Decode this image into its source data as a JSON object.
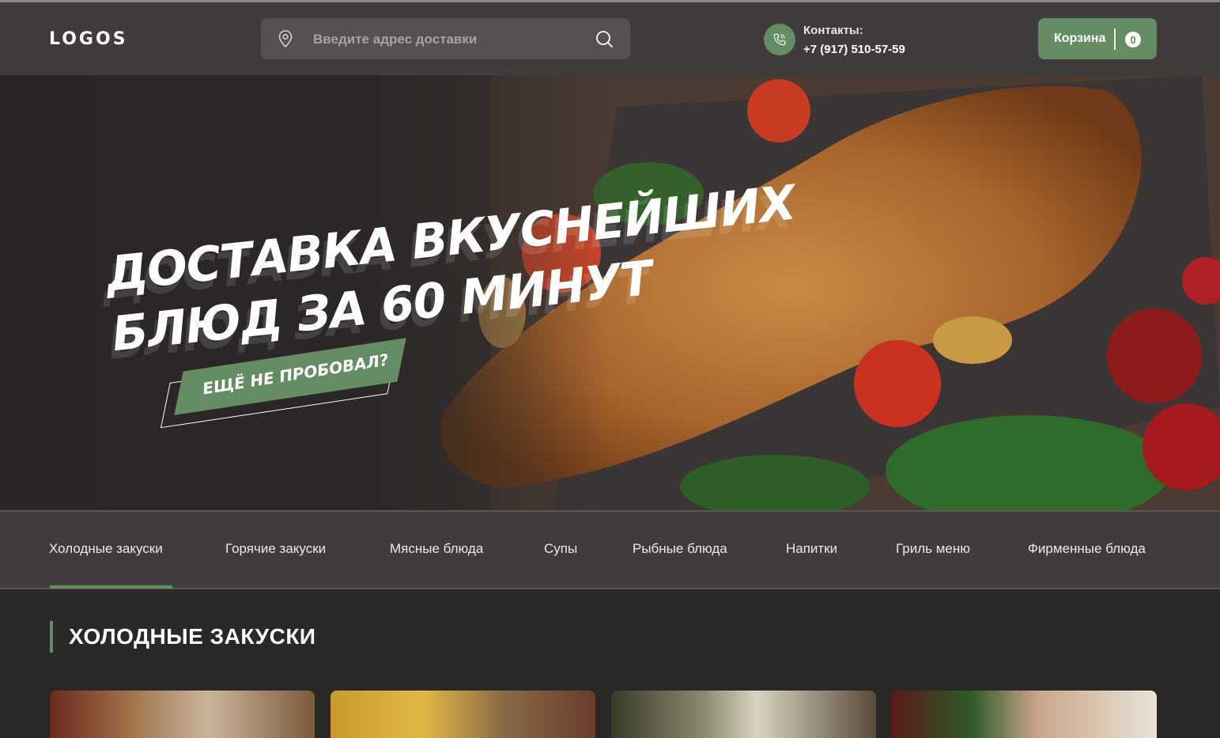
{
  "header": {
    "logo": "LOGOS",
    "search": {
      "placeholder": "Введите адрес доставки"
    },
    "contacts": {
      "label": "Контакты:",
      "phone": "+7 (917) 510-57-59"
    },
    "cart": {
      "label": "Корзина",
      "count": "0"
    }
  },
  "hero": {
    "title_line1": "ДОСТАВКА ВКУСНЕЙШИХ",
    "title_line2": "БЛЮД ЗА 60 МИНУТ",
    "badge": "ЕЩЁ НЕ ПРОБОВАЛ?"
  },
  "categories": {
    "active_index": 0,
    "items": [
      "Холодные закуски",
      "Горячие закуски",
      "Мясные блюда",
      "Супы",
      "Рыбные блюда",
      "Напитки",
      "Гриль меню",
      "Фирменные блюда"
    ]
  },
  "section": {
    "title": "ХОЛОДНЫЕ ЗАКУСКИ"
  },
  "colors": {
    "accent": "#668c66",
    "header_bg": "#403c3b",
    "page_bg": "#2b2828"
  },
  "icons": [
    "location-pin-icon",
    "search-icon",
    "phone-icon"
  ]
}
